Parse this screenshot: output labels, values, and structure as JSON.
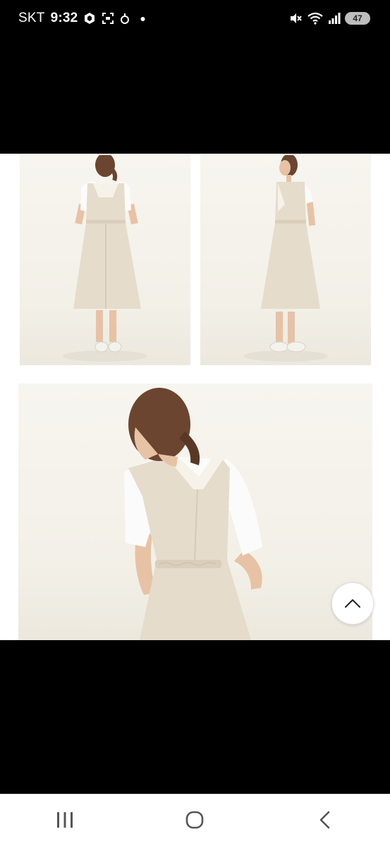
{
  "status_bar": {
    "carrier": "SKT",
    "time": "9:32",
    "battery": "47"
  },
  "product_photos": [
    {
      "view": "back"
    },
    {
      "view": "side"
    },
    {
      "view": "back-detail"
    }
  ],
  "scroll_top_icon": "chevron-up-icon",
  "nav_icons": [
    "recent-apps-icon",
    "home-icon",
    "back-icon"
  ],
  "colors": {
    "dress": "#e6dccb",
    "shirt": "#fbfbfb",
    "hair": "#6b4530",
    "skin": "#e7c2a4",
    "background": "#f5f3ed"
  }
}
